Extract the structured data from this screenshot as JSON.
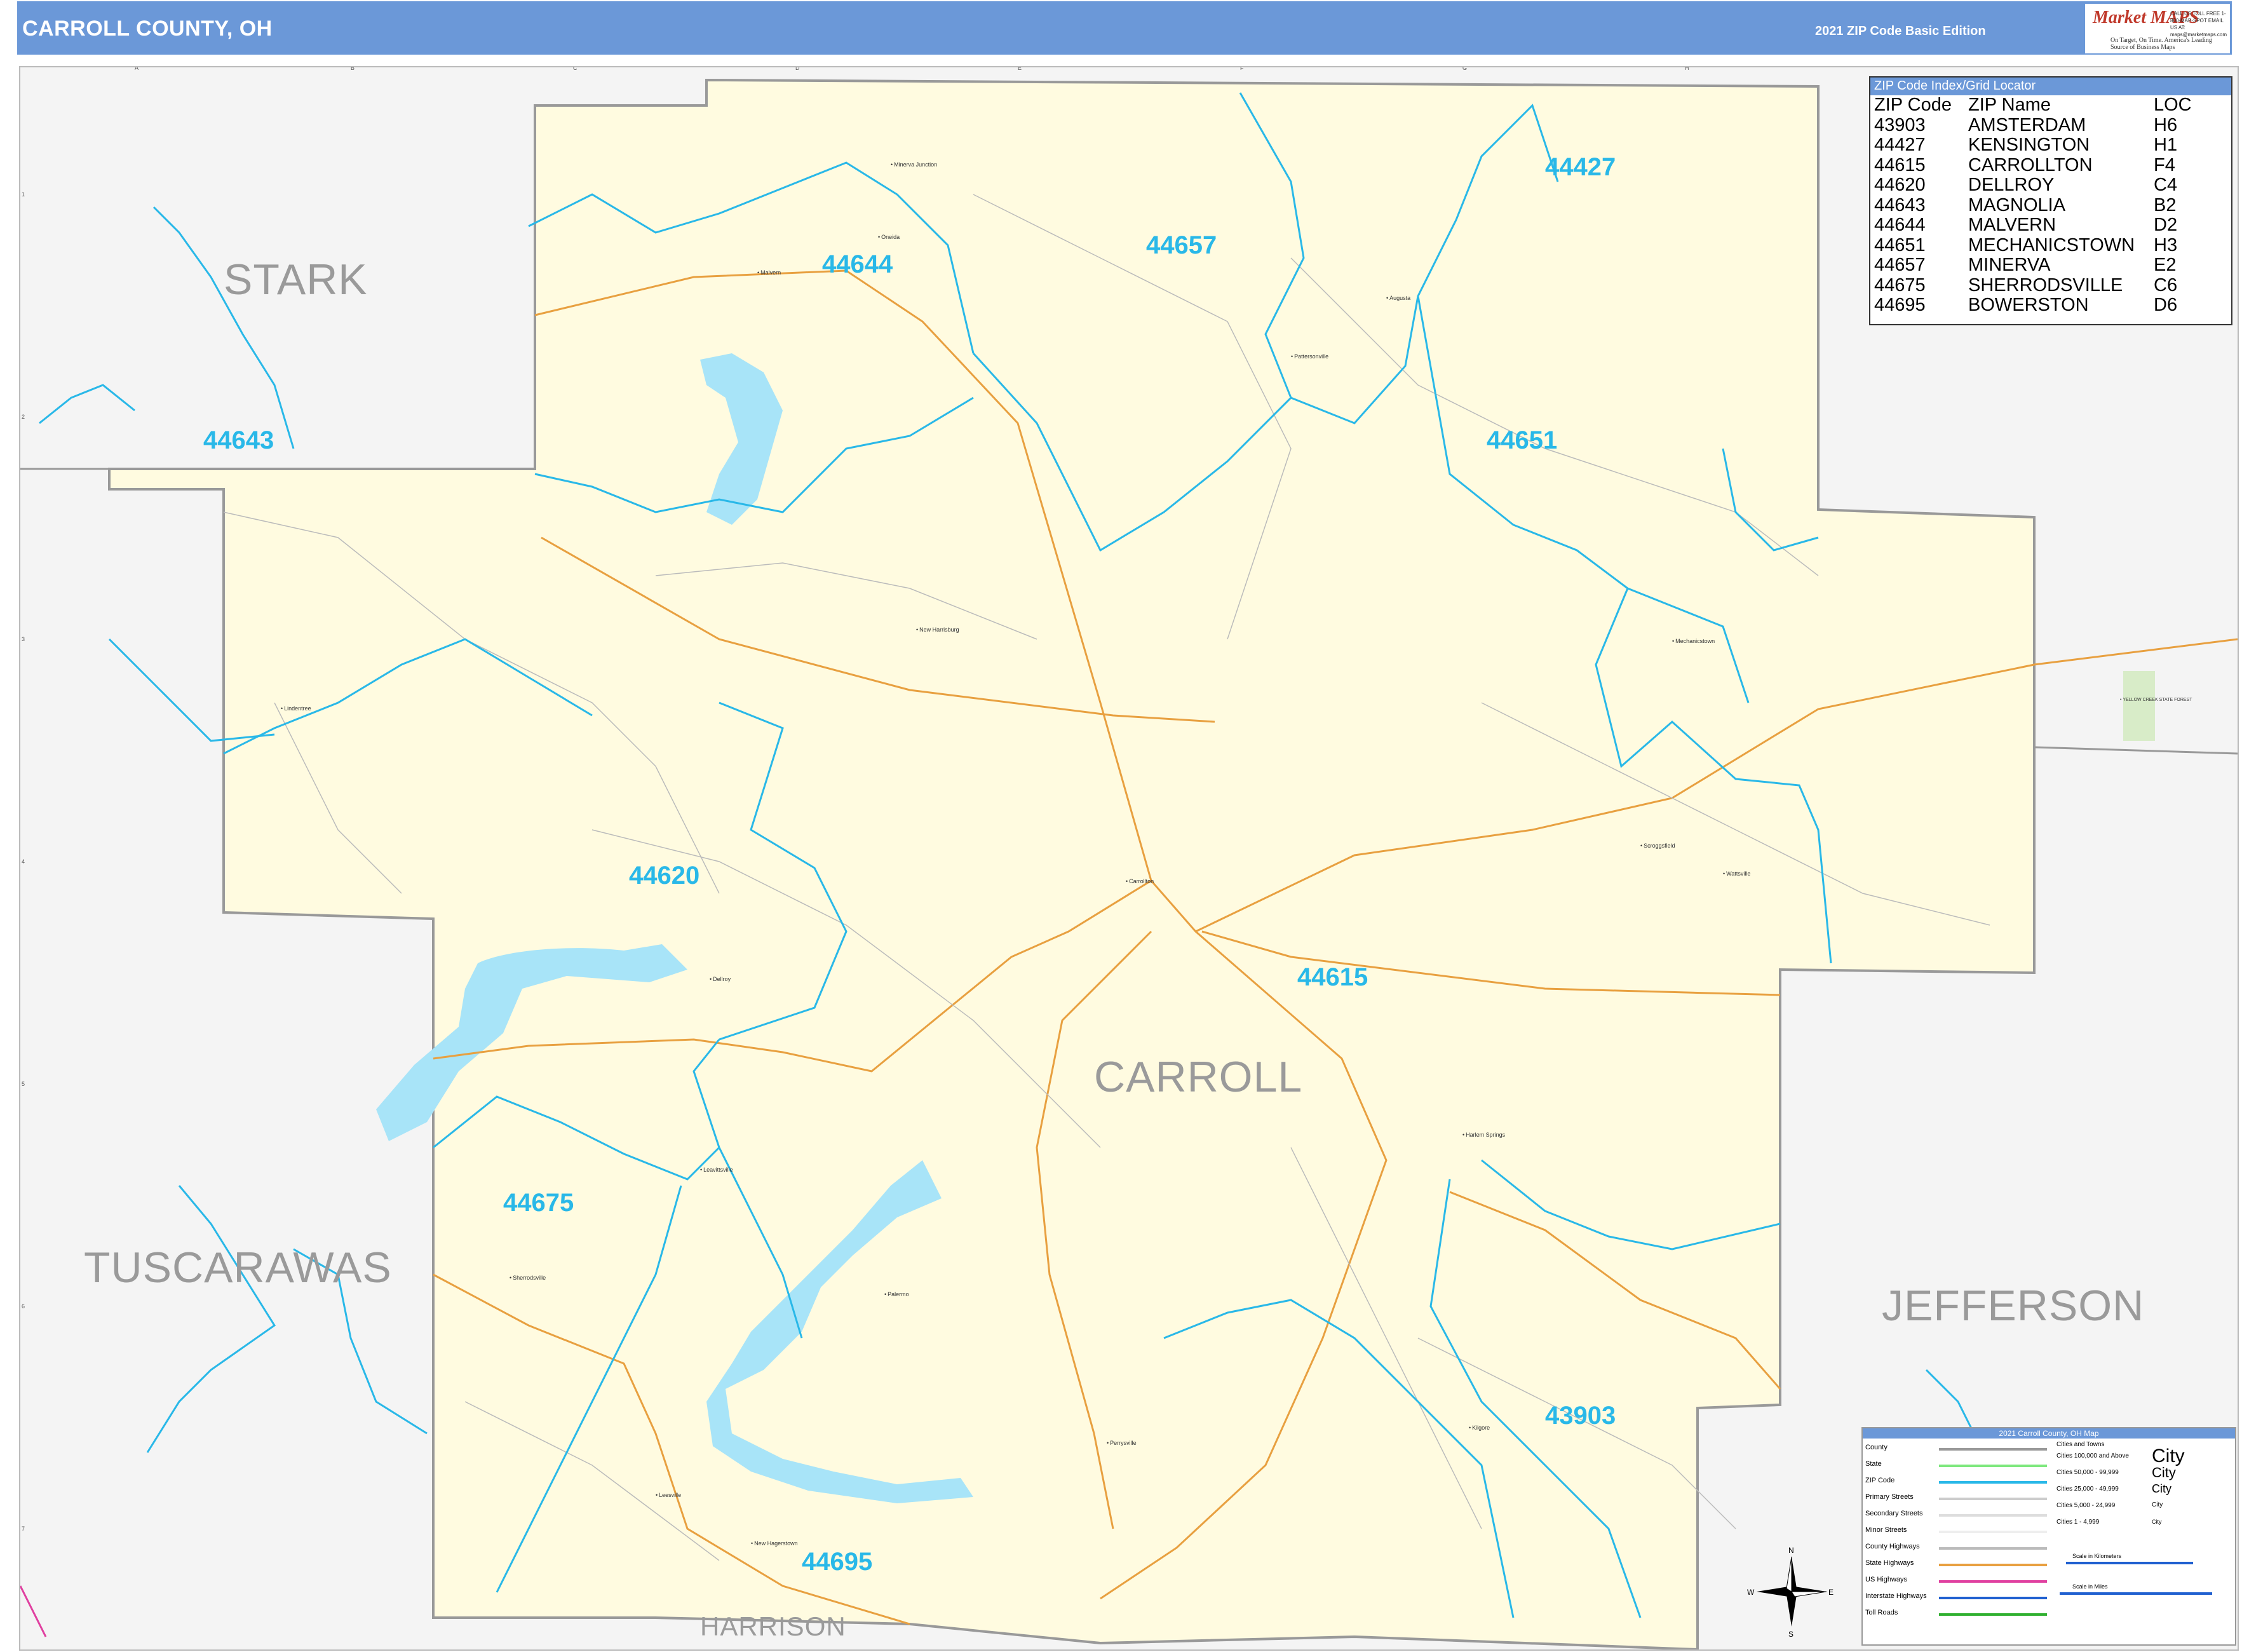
{
  "header": {
    "title": "CARROLL COUNTY, OH",
    "edition": "2021 ZIP Code Basic Edition",
    "logo": {
      "brand": "Market MAPS",
      "tagline": "On Target, On Time. America's Leading Source of Business Maps",
      "phone_text": "CALL US TOLL FREE 1-800-MAP-SPOT EMAIL US AT: maps@marketmaps.com"
    }
  },
  "grid": {
    "letters": [
      "A",
      "B",
      "C",
      "D",
      "E",
      "F",
      "G",
      "H"
    ],
    "numbers": [
      "1",
      "2",
      "3",
      "4",
      "5",
      "6",
      "7"
    ]
  },
  "counties": {
    "stark": "STARK",
    "carroll": "CARROLL",
    "tuscarawas": "TUSCARAWAS",
    "jefferson": "JEFFERSON",
    "harrison": "HARRISON"
  },
  "zip_labels": {
    "z44644": "44644",
    "z44657": "44657",
    "z44427": "44427",
    "z44643": "44643",
    "z44651": "44651",
    "z44620": "44620",
    "z44615": "44615",
    "z44675": "44675",
    "z43903": "43903",
    "z44695": "44695"
  },
  "towns": {
    "minerva_junction": "Minerva Junction",
    "malvern": "Malvern",
    "oneida": "Oneida",
    "augusta": "Augusta",
    "pattersonville": "Pattersonville",
    "new_harrisburg": "New Harrisburg",
    "mechanicstown": "Mechanicstown",
    "lindentree": "Lindentree",
    "carrollton": "Carrollton",
    "scroggsfield": "Scroggsfield",
    "wattsville": "Wattsville",
    "dellroy": "Dellroy",
    "harlem_springs": "Harlem Springs",
    "leavittsville": "Leavittsville",
    "sherrodsville": "Sherrodsville",
    "palermo": "Palermo",
    "perrysville": "Perrysville",
    "kilgore": "Kilgore",
    "leesville": "Leesville",
    "new_hagerstown": "New Hagerstown",
    "yellow_creek": "YELLOW CREEK STATE FOREST"
  },
  "zip_index": {
    "title": "ZIP Code Index/Grid Locator",
    "headers": [
      "ZIP Code",
      "ZIP Name",
      "LOC"
    ],
    "rows": [
      [
        "43903",
        "AMSTERDAM",
        "H6"
      ],
      [
        "44427",
        "KENSINGTON",
        "H1"
      ],
      [
        "44615",
        "CARROLLTON",
        "F4"
      ],
      [
        "44620",
        "DELLROY",
        "C4"
      ],
      [
        "44643",
        "MAGNOLIA",
        "B2"
      ],
      [
        "44644",
        "MALVERN",
        "D2"
      ],
      [
        "44651",
        "MECHANICSTOWN",
        "H3"
      ],
      [
        "44657",
        "MINERVA",
        "E2"
      ],
      [
        "44675",
        "SHERRODSVILLE",
        "C6"
      ],
      [
        "44695",
        "BOWERSTON",
        "D6"
      ]
    ]
  },
  "legend": {
    "title": "2021 Carroll County, OH Map",
    "items": [
      {
        "label": "County",
        "color": "#999999"
      },
      {
        "label": "State",
        "color": "#7ee87e"
      },
      {
        "label": "ZIP Code",
        "color": "#29b8e8"
      },
      {
        "label": "Primary Streets",
        "color": "#cccccc"
      },
      {
        "label": "Secondary Streets",
        "color": "#dddddd"
      },
      {
        "label": "Minor Streets",
        "color": "#eeeeee"
      },
      {
        "label": "County Highways",
        "color": "#bbbbbb"
      },
      {
        "label": "State Highways",
        "color": "#e8a040"
      },
      {
        "label": "US Highways",
        "color": "#e040a0"
      },
      {
        "label": "Interstate Highways",
        "color": "#2060d0"
      },
      {
        "label": "Toll Roads",
        "color": "#30b030"
      }
    ],
    "cities_header": "Cities and Towns",
    "cities": [
      {
        "label": "Cities 100,000 and Above",
        "sample": "City"
      },
      {
        "label": "Cities 50,000 - 99,999",
        "sample": "City"
      },
      {
        "label": "Cities 25,000 - 49,999",
        "sample": "City"
      },
      {
        "label": "Cities 5,000 - 24,999",
        "sample": "City"
      },
      {
        "label": "Cities 1 - 4,999",
        "sample": "City"
      }
    ],
    "scale_km": "Scale in Kilometers",
    "scale_mi": "Scale in Miles"
  },
  "colors": {
    "county_fill": "#fffbe0",
    "outside_fill": "#f4f4f4",
    "water": "#a8e4f8",
    "zip_line": "#29b8e8",
    "road_state": "#e8a040",
    "county_border": "#999999"
  }
}
